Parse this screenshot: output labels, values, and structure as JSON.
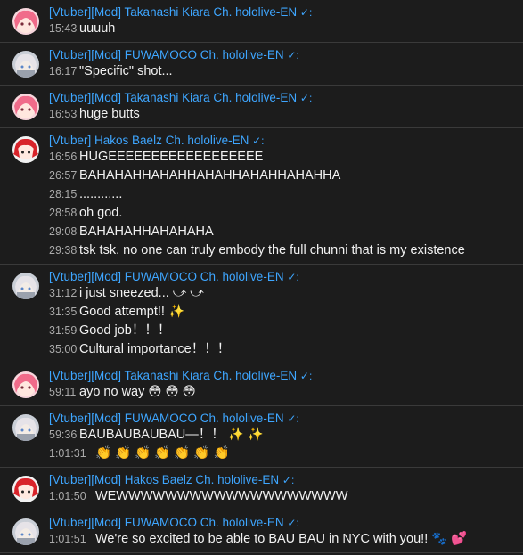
{
  "messages": [
    {
      "author": "[Vtuber][Mod] Takanashi Kiara Ch. hololive-EN",
      "avatar": "kiara",
      "lines": [
        {
          "time": "15:43",
          "text": "uuuuh"
        }
      ]
    },
    {
      "author": "[Vtuber][Mod] FUWAMOCO Ch. hololive-EN",
      "avatar": "fuwamoco",
      "lines": [
        {
          "time": "16:17",
          "text": "\"Specific\" shot..."
        }
      ]
    },
    {
      "author": "[Vtuber][Mod] Takanashi Kiara Ch. hololive-EN",
      "avatar": "kiara",
      "lines": [
        {
          "time": "16:53",
          "text": "huge butts"
        }
      ]
    },
    {
      "author": "[Vtuber] Hakos Baelz Ch. hololive-EN",
      "avatar": "baelz",
      "lines": [
        {
          "time": "16:56",
          "text": "HUGEEEEEEEEEEEEEEEEEE"
        },
        {
          "time": "26:57",
          "text": "BAHAHAHHAHAHHAHAHHAHAHHAHAHHA"
        },
        {
          "time": "28:15",
          "text": "............"
        },
        {
          "time": "28:58",
          "text": "oh god."
        },
        {
          "time": "29:08",
          "text": "BAHAHAHHAHAHAHA"
        },
        {
          "time": "29:38",
          "text": "tsk tsk. no one can truly embody the full chunni that is my existence"
        }
      ]
    },
    {
      "author": "[Vtuber][Mod] FUWAMOCO Ch. hololive-EN",
      "avatar": "fuwamoco",
      "lines": [
        {
          "time": "31:12",
          "text": "i just sneezed... ⤻ ⤻"
        },
        {
          "time": "31:35",
          "text": "Good attempt!! ✨"
        },
        {
          "time": "31:59",
          "text": "Good job！！！"
        },
        {
          "time": "35:00",
          "text": "Cultural importance！！！"
        }
      ]
    },
    {
      "author": "[Vtuber][Mod] Takanashi Kiara Ch. hololive-EN",
      "avatar": "kiara",
      "lines": [
        {
          "time": "59:11",
          "text": "ayo no way 😳 😳 😳"
        }
      ]
    },
    {
      "author": "[Vtuber][Mod] FUWAMOCO Ch. hololive-EN",
      "avatar": "fuwamoco",
      "lines": [
        {
          "time": "59:36",
          "text": "BAUBAUBAUBAU—！！ ✨ ✨"
        },
        {
          "time": "1:01:31",
          "text": "👏 👏 👏 👏 👏 👏 👏"
        }
      ]
    },
    {
      "author": "[Vtuber][Mod] Hakos Baelz Ch. hololive-EN",
      "avatar": "baelz",
      "lines": [
        {
          "time": "1:01:50",
          "text": "WEWWWWWWWWWWWWWWWWWWW"
        }
      ]
    },
    {
      "author": "[Vtuber][Mod] FUWAMOCO Ch. hololive-EN",
      "avatar": "fuwamoco",
      "lines": [
        {
          "time": "1:01:51",
          "text": "We're so excited to be able to BAU BAU in NYC with you!! 🐾 💕"
        }
      ]
    }
  ],
  "verified_mark": "✓:",
  "colors": {
    "background": "#1c1c1c",
    "author": "#3ea6ff",
    "timestamp": "#aaaaaa",
    "message": "#f1f1f1",
    "divider": "#3a3a3a"
  }
}
